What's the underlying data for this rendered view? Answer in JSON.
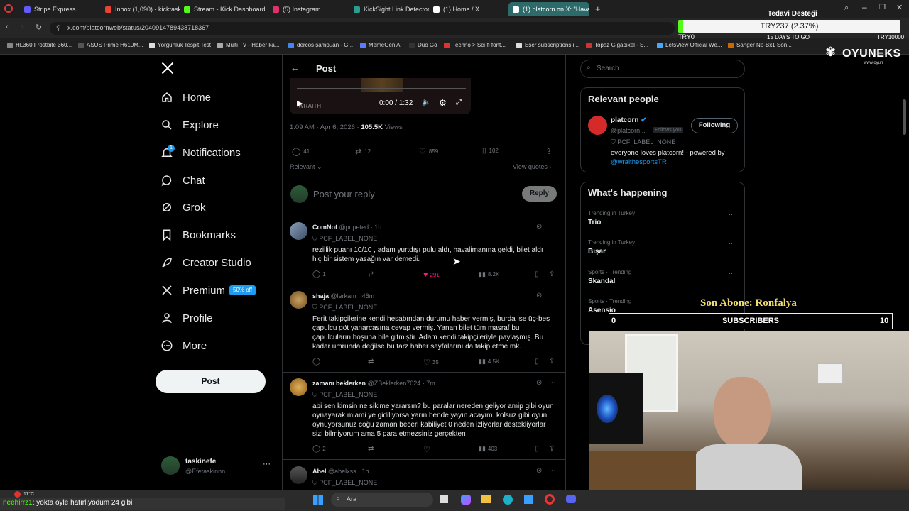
{
  "browser": {
    "tabs": [
      {
        "label": "Stripe Express",
        "color": "#635bff"
      },
      {
        "label": "Inbox (1,090) - kicktaskine",
        "color": "#ea4335"
      },
      {
        "label": "Stream - Kick Dashboard",
        "color": "#53fc18"
      },
      {
        "label": "(5) Instagram",
        "color": "#e1306c"
      },
      {
        "label": "KickSight Link Detector",
        "color": "#2a9d8f"
      },
      {
        "label": "(1) Home / X",
        "color": "#ffffff"
      },
      {
        "label": "(1) platcorn on X: \"Havaal",
        "color": "#ffffff"
      }
    ],
    "url": "x.com/platcornweb/status/2040914789438718367",
    "bookmarks": [
      "HL360 Frostbite 360...",
      "ASUS Prime H610M...",
      "Yorgunluk Tespit Test",
      "Multi TV - Haber ka...",
      "dercos şampuan - G...",
      "MemeGen AI",
      "Duo Go",
      "Techno > Sci-fi font...",
      "Eser subscriptions i...",
      "Topaz Gigapixel - S...",
      "LetsView Official We...",
      "Sanger Np-Bx1 Son..."
    ]
  },
  "stream_overlay": {
    "goal_title": "Tedavi Desteği",
    "goal_amount": "TRY237 (2.37%)",
    "goal_min": "TRY0",
    "goal_days": "15 DAYS TO GO",
    "goal_max": "TRY10000",
    "goal_progress": 0.0237,
    "brand": "OYUNEKS",
    "brand_sub": "www.oyun",
    "last_sub_label": "Son Abone: Ronfalya",
    "sub_count_left": "0",
    "sub_label": "SUBSCRIBERS",
    "sub_count_right": "10",
    "chat_user": "neehirrz1",
    "chat_msg": ": yokta öyle hatırlıyodum 24 gibi",
    "weather": "11°C"
  },
  "nav": {
    "items": [
      {
        "label": "Home",
        "icon": "home-icon"
      },
      {
        "label": "Explore",
        "icon": "search-icon"
      },
      {
        "label": "Notifications",
        "icon": "bell-icon"
      },
      {
        "label": "Chat",
        "icon": "chat-icon"
      },
      {
        "label": "Grok",
        "icon": "grok-icon"
      },
      {
        "label": "Bookmarks",
        "icon": "bookmark-icon"
      },
      {
        "label": "Creator Studio",
        "icon": "rocket-icon"
      },
      {
        "label": "Premium",
        "icon": "x-icon"
      },
      {
        "label": "Profile",
        "icon": "person-icon"
      },
      {
        "label": "More",
        "icon": "more-icon"
      }
    ],
    "notif_badge": "1",
    "premium_badge": "50% off",
    "post_button": "Post",
    "account_name": "taskinefe",
    "account_handle": "@Efetaskinnn"
  },
  "post": {
    "header": "Post",
    "video_time": "0:00 / 1:32",
    "video_label": "WRAITH",
    "timestamp": "1:09 AM · Apr 6, 2026 · ",
    "views_count": "105.5K",
    "views_label": " Views",
    "replies": "41",
    "reposts": "12",
    "likes": "859",
    "bookmarks": "102",
    "sort": "Relevant",
    "view_quotes": "View quotes",
    "reply_placeholder": "Post your reply",
    "reply_button": "Reply"
  },
  "replies": [
    {
      "name": "ComNot",
      "handle": "@pupeted · 1h",
      "label": "PCF_LABEL_NONE",
      "text": "rezillik puanı 10/10 , adam yurtdışı pulu aldı, havalimanına geldi, bilet aldı hiç bir sistem yasağın var demedi.",
      "replies": "1",
      "reposts": "",
      "likes": "291",
      "views": "8.2K"
    },
    {
      "name": "shaja",
      "handle": "@lerkam · 46m",
      "label": "PCF_LABEL_NONE",
      "text": "Ferit takipçilerine kendi hesabından durumu haber vermiş, burda ise üç-beş çapulcu göt yanarcasına cevap vermiş. Yanan bilet tüm masraf bu çapulcuların hoşuna bile gitmiştir. Adam kendi takipçileriyle paylaşmış. Bu kadar umrunda değilse bu tarz haber sayfalarını da takip etme mk.",
      "replies": "",
      "reposts": "",
      "likes": "35",
      "views": "4.5K"
    },
    {
      "name": "zamanı beklerken",
      "handle": "@ZBeklerken7024 · 7m",
      "label": "PCF_LABEL_NONE",
      "text": "abi sen kimsin ne sikime yararsın? bu paralar nereden geliyor amip gibi oyun oynayarak miami ye gidiliyorsa yarın bende yayın acayım. kolsuz gibi oyun oynuyorsunuz coğu zaman beceri kabiliyet 0 neden izliyorlar destekliyorlar sizi bilmiyorum ama 5 para etmezsiniz gerçekten",
      "replies": "2",
      "reposts": "",
      "likes": "",
      "views": "403"
    },
    {
      "name": "Abel",
      "handle": "@abelxss · 1h",
      "label": "PCF_LABEL_NONE",
      "text": "",
      "replies": "",
      "reposts": "",
      "likes": "",
      "views": ""
    }
  ],
  "right": {
    "search_placeholder": "Search",
    "relevant_title": "Relevant people",
    "person_name": "platcorn",
    "person_handle": "@platcorn...",
    "follows_you": "Follows you",
    "following_button": "Following",
    "person_label": "PCF_LABEL_NONE",
    "person_bio": "everyone loves platcorn! - powered by",
    "person_link": "@wraithesportsTR",
    "happening_title": "What's happening",
    "trends": [
      {
        "context": "Trending in Turkey",
        "topic": "Trio"
      },
      {
        "context": "Trending in Turkey",
        "topic": "Bışar"
      },
      {
        "context": "Sports · Trending",
        "topic": "Skandal"
      },
      {
        "context": "Sports · Trending",
        "topic": "Asensio"
      }
    ]
  },
  "taskbar": {
    "search": "Ara"
  }
}
